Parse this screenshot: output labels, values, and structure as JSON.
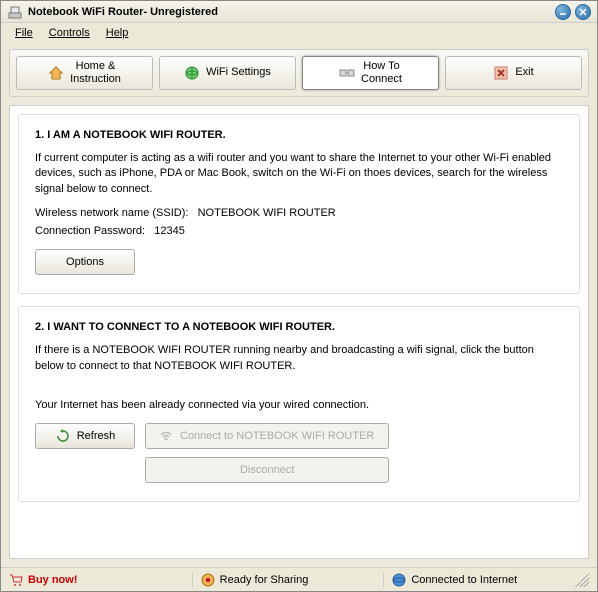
{
  "window": {
    "title": "Notebook WiFi Router- Unregistered"
  },
  "menu": {
    "file": "File",
    "controls": "Controls",
    "help": "Help"
  },
  "tabs": {
    "home": "Home & Instruction",
    "wifi": "WiFi Settings",
    "howto": "How To Connect",
    "exit": "Exit"
  },
  "section1": {
    "heading": "1. I AM A NOTEBOOK WIFI ROUTER.",
    "body": "If current computer is acting as a wifi router and you want to share the Internet to your other Wi-Fi enabled devices, such as iPhone, PDA or Mac Book, switch on the Wi-Fi on thoes devices, search for the wireless signal below to connect.",
    "ssid_label": "Wireless network name (SSID):",
    "ssid_value": "NOTEBOOK WIFI ROUTER",
    "pwd_label": "Connection Password:",
    "pwd_value": "12345",
    "options_btn": "Options"
  },
  "section2": {
    "heading": "2. I WANT TO CONNECT TO A NOTEBOOK WIFI ROUTER.",
    "body": "If there is a NOTEBOOK WIFI ROUTER running nearby and broadcasting a wifi signal, click the button below to connect to that NOTEBOOK WIFI ROUTER.",
    "status": "Your Internet has been already connected via your wired connection.",
    "refresh_btn": "Refresh",
    "connect_btn": "Connect to NOTEBOOK WIFI ROUTER",
    "disconnect_btn": "Disconnect"
  },
  "statusbar": {
    "buy": "Buy now!",
    "ready": "Ready for Sharing",
    "connected": "Connected to Internet"
  }
}
